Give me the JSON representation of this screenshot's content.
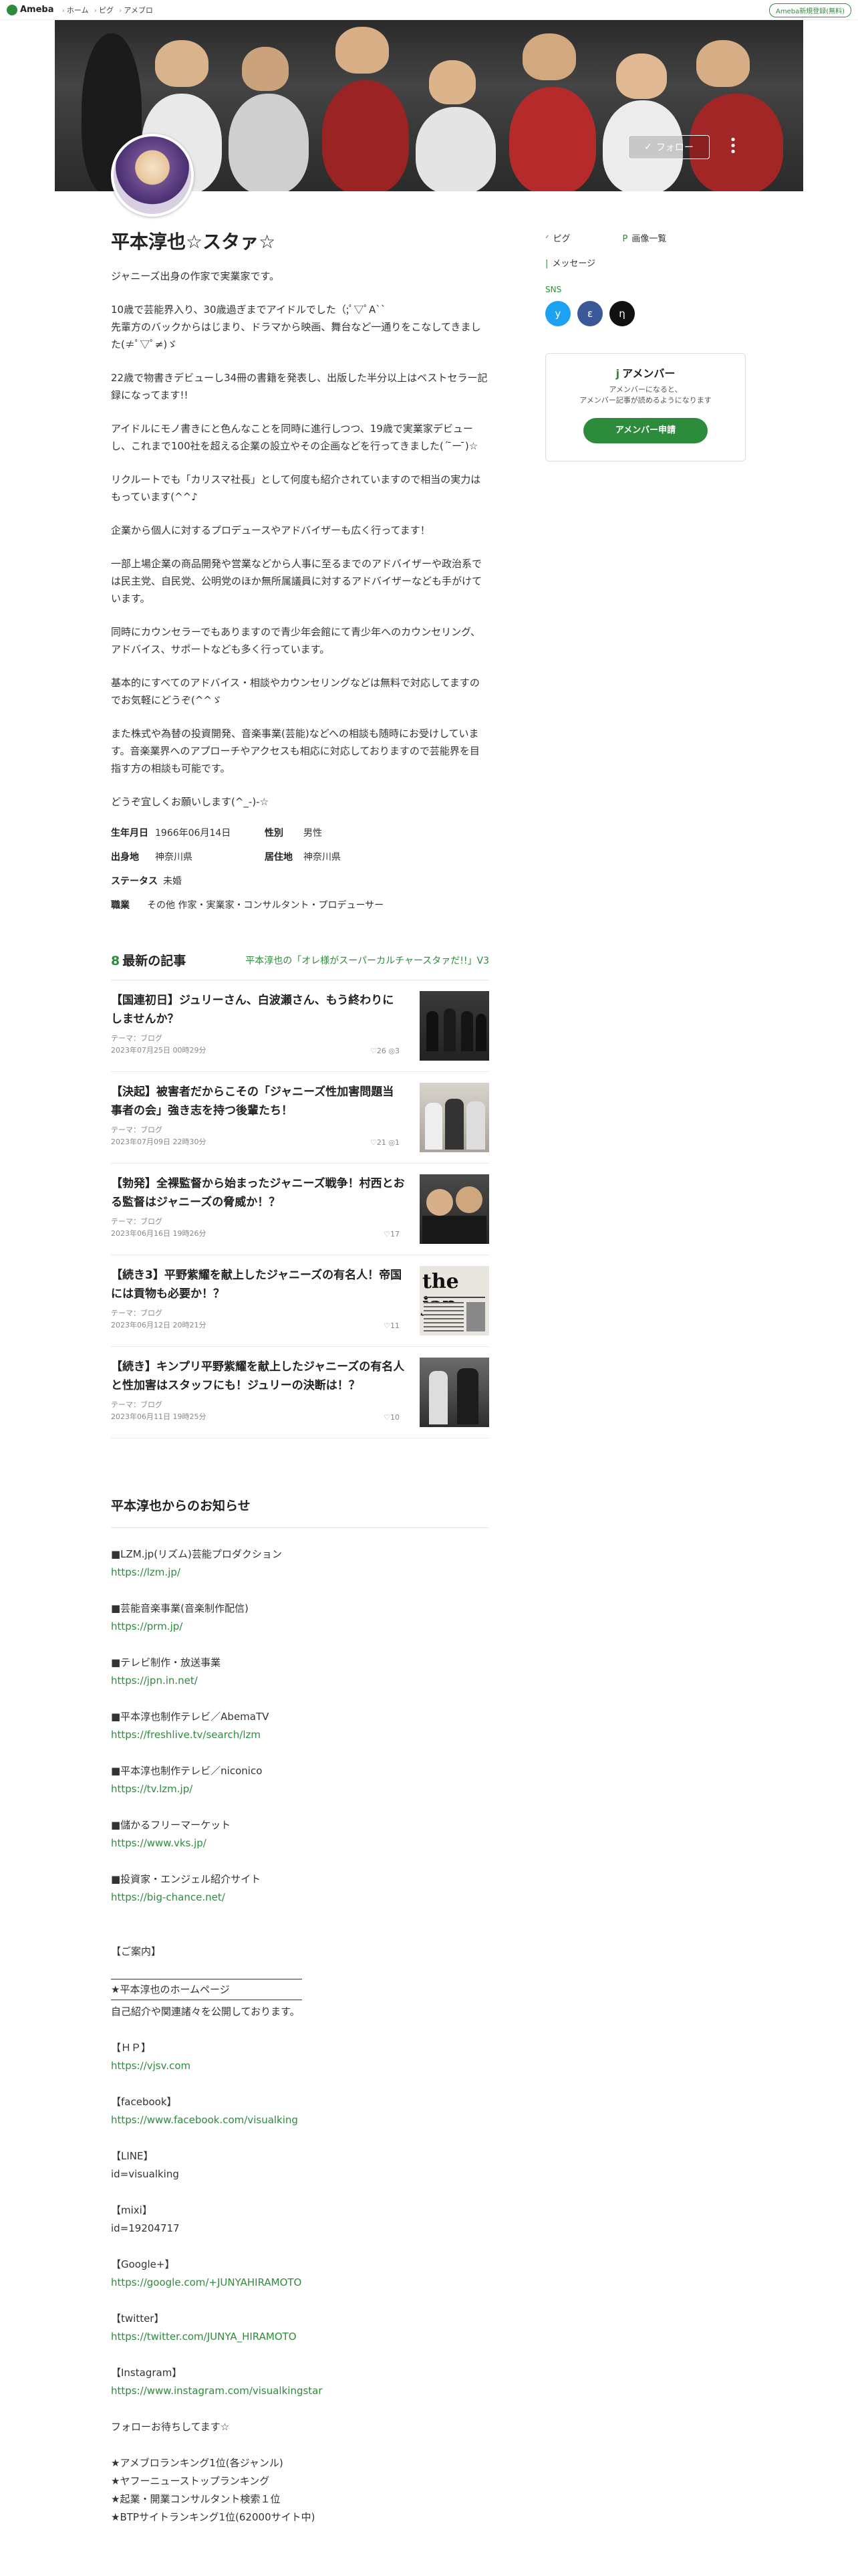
{
  "topbar": {
    "logo": "Ameba",
    "breadcrumbs": [
      "ホーム",
      "ピグ",
      "アメブロ"
    ],
    "register": "Ameba新規登録(無料)"
  },
  "cover": {
    "follow_label": "フォロー"
  },
  "blog": {
    "title": "平本淳也☆スタァ☆",
    "bio": [
      "ジャニーズ出身の作家で実業家です。",
      "10歳で芸能界入り、30歳過ぎまでアイドルでした（;ﾟ▽ﾟA``\n先輩方のバックからはじまり、ドラマから映画、舞台など一通りをこなしてきました(≠ﾟ▽ﾟ≠)ゞ",
      "22歳で物書きデビューし34冊の書籍を発表し、出版した半分以上はベストセラー記録になってます!!",
      "アイドルにモノ書きにと色んなことを同時に進行しつつ、19歳で実業家デビューし、これまで100社を超える企業の設立やその企画などを行ってきました(´ ̄ー ̄)☆",
      "リクルートでも「カリスマ社長」として何度も紹介されていますので相当の実力はもっています(^^♪",
      "企業から個人に対するプロデュースやアドバイザーも広く行ってます！",
      "一部上場企業の商品開発や営業などから人事に至るまでのアドバイザーや政治系では民主党、自民党、公明党のほか無所属議員に対するアドバイザーなども手がけています。",
      "同時にカウンセラーでもありますので青少年会館にて青少年へのカウンセリング、アドバイス、サポートなども多く行っています。",
      "基本的にすべてのアドバイス・相談やカウンセリングなどは無料で対応してますのでお気軽にどうぞ(^^ゞ",
      "また株式や為替の投資開発、音楽事業(芸能)などへの相談も随時にお受けしています。音楽業界へのアプローチやアクセスも相応に対応しておりますので芸能界を目指す方の相談も可能です。",
      "どうぞ宜しくお願いします(^_-)-☆"
    ],
    "profile": {
      "birthday_label": "生年月日",
      "birthday": "1966年06月14日",
      "gender_label": "性別",
      "gender": "男性",
      "birthplace_label": "出身地",
      "birthplace": "神奈川県",
      "residence_label": "居住地",
      "residence": "神奈川県",
      "status_label": "ステータス",
      "status": "未婚",
      "job_label": "職業",
      "job": "その他 作家・実業家・コンサルタント・プロデューサー"
    }
  },
  "latest": {
    "title": "最新の記事",
    "link": "平本淳也の「オレ様がスーパーカルチャースタァだ!!」V3",
    "articles": [
      {
        "title": "【国連初日】ジュリーさん、白波瀬さん、もう終わりにしませんか？",
        "theme": "テーマ：ブログ",
        "date": "2023年07月25日 00時29分",
        "stats": "♡26  ◎3"
      },
      {
        "title": "【決起】被害者だからこその「ジャニーズ性加害問題当事者の会」強き志を持つ後輩たち！",
        "theme": "テーマ：ブログ",
        "date": "2023年07月09日 22時30分",
        "stats": "♡21  ◎1"
      },
      {
        "title": "【勃発】全裸監督から始まったジャニーズ戦争！村西とおる監督はジャニーズの脅威か！？",
        "theme": "テーマ：ブログ",
        "date": "2023年06月16日 19時26分",
        "stats": "♡17"
      },
      {
        "title": "【続き3】平野紫耀を献上したジャニーズの有名人！帝国には貢物も必要か！？",
        "theme": "テーマ：ブログ",
        "date": "2023年06月12日 20時21分",
        "stats": "♡11"
      },
      {
        "title": "【続き】キンプリ平野紫耀を献上したジャニーズの有名人と性加害はスタッフにも！ジュリーの決断は！？",
        "theme": "テーマ：ブログ",
        "date": "2023年06月11日 19時25分",
        "stats": "♡10"
      }
    ]
  },
  "notice": {
    "title": "平本淳也からのお知らせ",
    "blocks": [
      {
        "label": "■LZM.jp(リズム)芸能プロダクション",
        "url": "https://lzm.jp/"
      },
      {
        "label": "■芸能音楽事業(音楽制作配信)",
        "url": "https://prm.jp/"
      },
      {
        "label": "■テレビ制作・放送事業",
        "url": "https://jpn.in.net/"
      },
      {
        "label": "■平本淳也制作テレビ／AbemaTV",
        "url": "https://freshlive.tv/search/lzm"
      },
      {
        "label": "■平本淳也制作テレビ／niconico",
        "url": "https://tv.lzm.jp/"
      },
      {
        "label": "■儲かるフリーマーケット",
        "url": "https://www.vks.jp/"
      },
      {
        "label": "■投資家・エンジェル紹介サイト",
        "url": "https://big-chance.net/"
      }
    ],
    "guide": "【ご案内】",
    "homepage": "★平本淳也のホームページ",
    "intro": "自己紹介や関連諸々を公開しております。",
    "hp_label": "【ＨＰ】",
    "hp_url": "https://vjsv.com",
    "fb_label": "【facebook】",
    "fb_url": "https://www.facebook.com/visualking",
    "line_label": "【LINE】",
    "line_id": "id=visualking",
    "mixi_label": "【mixi】",
    "mixi_id": "id=19204717",
    "google_label": "【Google+】",
    "google_url": "https://google.com/+JUNYAHIRAMOTO",
    "twitter_label": "【twitter】",
    "twitter_url": "https://twitter.com/JUNYA_HIRAMOTO",
    "insta_label": "【Instagram】",
    "insta_url": "https://www.instagram.com/visualkingstar",
    "follow_wait": "フォローお待ちしてます☆",
    "rankings": [
      "★アメブロランキング1位(各ジャンル)",
      "★ヤフーニューストップランキング",
      "★起業・開業コンサルタント検索１位",
      "★BTPサイトランキング1位(62000サイト中)"
    ]
  },
  "sidebar": {
    "pigg": "ピグ",
    "images": "画像一覧",
    "message": "メッセージ",
    "sns_label": "SNS",
    "sns": [
      {
        "icon": "twitter-icon",
        "glyph": "y",
        "color": "#1da1f2"
      },
      {
        "icon": "facebook-icon",
        "glyph": "ε",
        "color": "#3b5998"
      },
      {
        "icon": "threads-icon",
        "glyph": "η",
        "color": "#111111"
      }
    ],
    "amember_title": "アメンバー",
    "amember_text1": "アメンバーになると、",
    "amember_text2": "アメンバー記事が読めるようになります",
    "amember_btn": "アメンバー申請"
  }
}
